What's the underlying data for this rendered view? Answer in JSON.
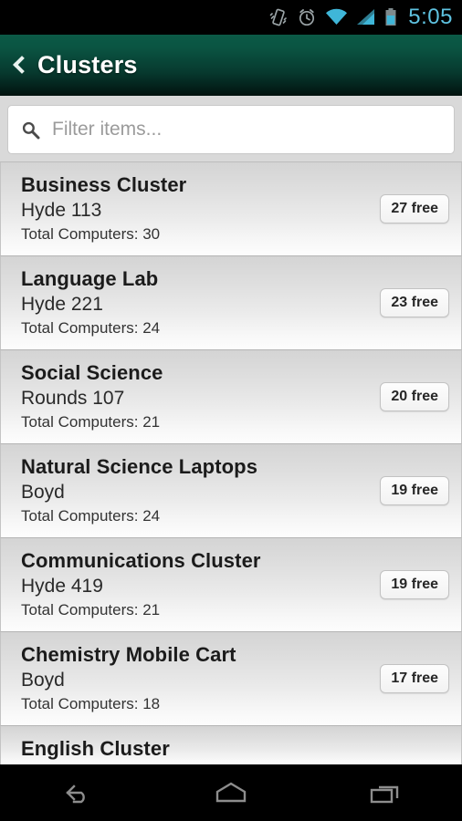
{
  "statusbar": {
    "time": "5:05",
    "icons": [
      "vibrate-icon",
      "alarm-clock-icon",
      "wifi-icon",
      "cellular-signal-icon",
      "battery-icon"
    ],
    "accent_color": "#5ec2e0"
  },
  "actionbar": {
    "title": "Clusters",
    "back_label": "Back",
    "color_top": "#0a5442",
    "color_bottom": "#021410"
  },
  "search": {
    "placeholder": "Filter items...",
    "value": "",
    "icon": "search-icon"
  },
  "list": {
    "items": [
      {
        "title": "Business Cluster",
        "location": "Hyde 113",
        "total": "Total Computers: 30",
        "badge": "27 free"
      },
      {
        "title": "Language Lab",
        "location": "Hyde 221",
        "total": "Total Computers: 24",
        "badge": "23 free"
      },
      {
        "title": "Social Science",
        "location": "Rounds 107",
        "total": "Total Computers: 21",
        "badge": "20 free"
      },
      {
        "title": "Natural Science Laptops",
        "location": "Boyd",
        "total": "Total Computers: 24",
        "badge": "19 free"
      },
      {
        "title": "Communications Cluster",
        "location": "Hyde 419",
        "total": "Total Computers: 21",
        "badge": "19 free"
      },
      {
        "title": "Chemistry Mobile Cart",
        "location": "Boyd",
        "total": "Total Computers: 18",
        "badge": "17 free"
      },
      {
        "title": "English Cluster",
        "location": "",
        "total": "",
        "badge": ""
      }
    ]
  },
  "navbar": {
    "back_label": "Back",
    "home_label": "Home",
    "recents_label": "Recent apps"
  }
}
